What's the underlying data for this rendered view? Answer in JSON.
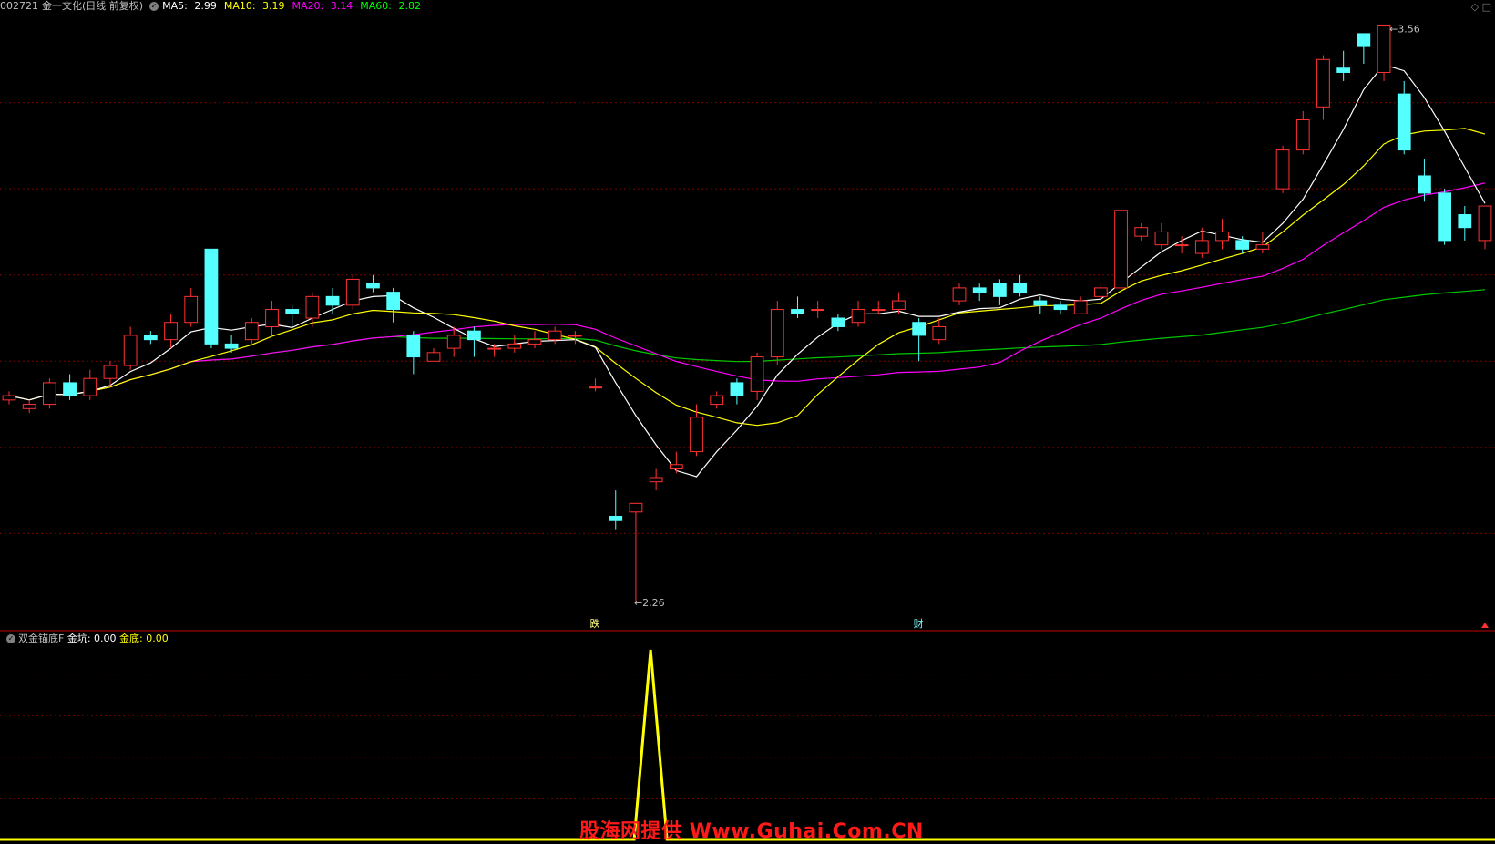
{
  "header": {
    "stock_code": "002721",
    "stock_name": "金一文化(日线 前复权)",
    "ma5_label": "MA5:",
    "ma5_value": "2.99",
    "ma10_label": "MA10:",
    "ma10_value": "3.19",
    "ma20_label": "MA20:",
    "ma20_value": "3.14",
    "ma60_label": "MA60:",
    "ma60_value": "2.82"
  },
  "topright_icons": [
    "◇",
    "□"
  ],
  "indicator": {
    "name": "双金锚底F",
    "line1_label": "金坑:",
    "line1_value": "0.00",
    "line2_label": "金底:",
    "line2_value": "0.00"
  },
  "annotations": {
    "high_label": "3.56",
    "low_label": "2.26",
    "marker1": "跌",
    "marker2": "财"
  },
  "watermark": "股海网提供 Www.Guhai.Com.CN",
  "colors": {
    "up": "#ff3232",
    "down": "#54ffff",
    "ma5": "#ffffff",
    "ma10": "#ffff00",
    "ma20": "#ff00ff",
    "ma60": "#00c800",
    "grid": "#800000",
    "indicator": "#ffff00"
  },
  "chart_data": {
    "type": "candlestick",
    "price_range": [
      2.2,
      3.6
    ],
    "candles": [
      [
        2.71,
        2.72,
        2.7,
        2.73
      ],
      [
        2.69,
        2.7,
        2.68,
        2.71
      ],
      [
        2.7,
        2.75,
        2.69,
        2.76
      ],
      [
        2.75,
        2.72,
        2.71,
        2.77
      ],
      [
        2.72,
        2.76,
        2.71,
        2.78
      ],
      [
        2.76,
        2.79,
        2.74,
        2.8
      ],
      [
        2.79,
        2.86,
        2.78,
        2.88
      ],
      [
        2.86,
        2.85,
        2.84,
        2.87
      ],
      [
        2.85,
        2.89,
        2.83,
        2.91
      ],
      [
        2.89,
        2.95,
        2.88,
        2.97
      ],
      [
        3.06,
        2.84,
        2.83,
        3.06
      ],
      [
        2.84,
        2.83,
        2.82,
        2.86
      ],
      [
        2.85,
        2.89,
        2.84,
        2.9
      ],
      [
        2.88,
        2.92,
        2.86,
        2.94
      ],
      [
        2.92,
        2.91,
        2.88,
        2.93
      ],
      [
        2.9,
        2.95,
        2.88,
        2.96
      ],
      [
        2.95,
        2.93,
        2.91,
        2.97
      ],
      [
        2.93,
        2.99,
        2.92,
        3.0
      ],
      [
        2.98,
        2.97,
        2.96,
        3.0
      ],
      [
        2.96,
        2.92,
        2.89,
        2.97
      ],
      [
        2.86,
        2.81,
        2.77,
        2.87
      ],
      [
        2.8,
        2.82,
        2.8,
        2.83
      ],
      [
        2.83,
        2.86,
        2.81,
        2.88
      ],
      [
        2.87,
        2.85,
        2.81,
        2.88
      ],
      [
        2.83,
        2.83,
        2.81,
        2.84
      ],
      [
        2.83,
        2.84,
        2.82,
        2.86
      ],
      [
        2.84,
        2.85,
        2.83,
        2.87
      ],
      [
        2.85,
        2.87,
        2.84,
        2.88
      ],
      [
        2.86,
        2.86,
        2.84,
        2.87
      ],
      [
        2.74,
        2.74,
        2.73,
        2.76
      ],
      [
        2.44,
        2.43,
        2.41,
        2.5
      ],
      [
        2.45,
        2.47,
        2.24,
        2.47
      ],
      [
        2.52,
        2.53,
        2.5,
        2.55
      ],
      [
        2.55,
        2.56,
        2.54,
        2.59
      ],
      [
        2.59,
        2.67,
        2.58,
        2.7
      ],
      [
        2.7,
        2.72,
        2.69,
        2.73
      ],
      [
        2.75,
        2.72,
        2.7,
        2.76
      ],
      [
        2.73,
        2.81,
        2.71,
        2.82
      ],
      [
        2.81,
        2.92,
        2.79,
        2.94
      ],
      [
        2.92,
        2.91,
        2.9,
        2.95
      ],
      [
        2.92,
        2.92,
        2.9,
        2.94
      ],
      [
        2.9,
        2.88,
        2.87,
        2.91
      ],
      [
        2.89,
        2.92,
        2.88,
        2.94
      ],
      [
        2.92,
        2.92,
        2.91,
        2.94
      ],
      [
        2.92,
        2.94,
        2.91,
        2.96
      ],
      [
        2.89,
        2.86,
        2.8,
        2.9
      ],
      [
        2.85,
        2.88,
        2.84,
        2.9
      ],
      [
        2.94,
        2.97,
        2.93,
        2.98
      ],
      [
        2.97,
        2.96,
        2.94,
        2.98
      ],
      [
        2.98,
        2.95,
        2.93,
        2.99
      ],
      [
        2.98,
        2.96,
        2.95,
        3.0
      ],
      [
        2.94,
        2.93,
        2.91,
        2.95
      ],
      [
        2.93,
        2.92,
        2.91,
        2.94
      ],
      [
        2.91,
        2.94,
        2.91,
        2.95
      ],
      [
        2.95,
        2.97,
        2.94,
        2.98
      ],
      [
        2.97,
        3.15,
        2.96,
        3.16
      ],
      [
        3.09,
        3.11,
        3.08,
        3.12
      ],
      [
        3.07,
        3.1,
        3.06,
        3.12
      ],
      [
        3.07,
        3.07,
        3.05,
        3.09
      ],
      [
        3.05,
        3.08,
        3.04,
        3.11
      ],
      [
        3.08,
        3.1,
        3.06,
        3.13
      ],
      [
        3.08,
        3.06,
        3.05,
        3.09
      ],
      [
        3.06,
        3.07,
        3.05,
        3.1
      ],
      [
        3.2,
        3.29,
        3.19,
        3.3
      ],
      [
        3.29,
        3.36,
        3.28,
        3.38
      ],
      [
        3.39,
        3.5,
        3.36,
        3.51
      ],
      [
        3.48,
        3.47,
        3.45,
        3.52
      ],
      [
        3.56,
        3.53,
        3.49,
        3.56
      ],
      [
        3.47,
        3.58,
        3.45,
        3.58
      ],
      [
        3.42,
        3.29,
        3.28,
        3.45
      ],
      [
        3.23,
        3.19,
        3.17,
        3.27
      ],
      [
        3.19,
        3.08,
        3.07,
        3.2
      ],
      [
        3.14,
        3.11,
        3.08,
        3.16
      ],
      [
        3.08,
        3.16,
        3.06,
        3.16
      ]
    ],
    "indicator_series": {
      "name": "金坑",
      "spike_value": 1,
      "baseline": 0
    }
  }
}
